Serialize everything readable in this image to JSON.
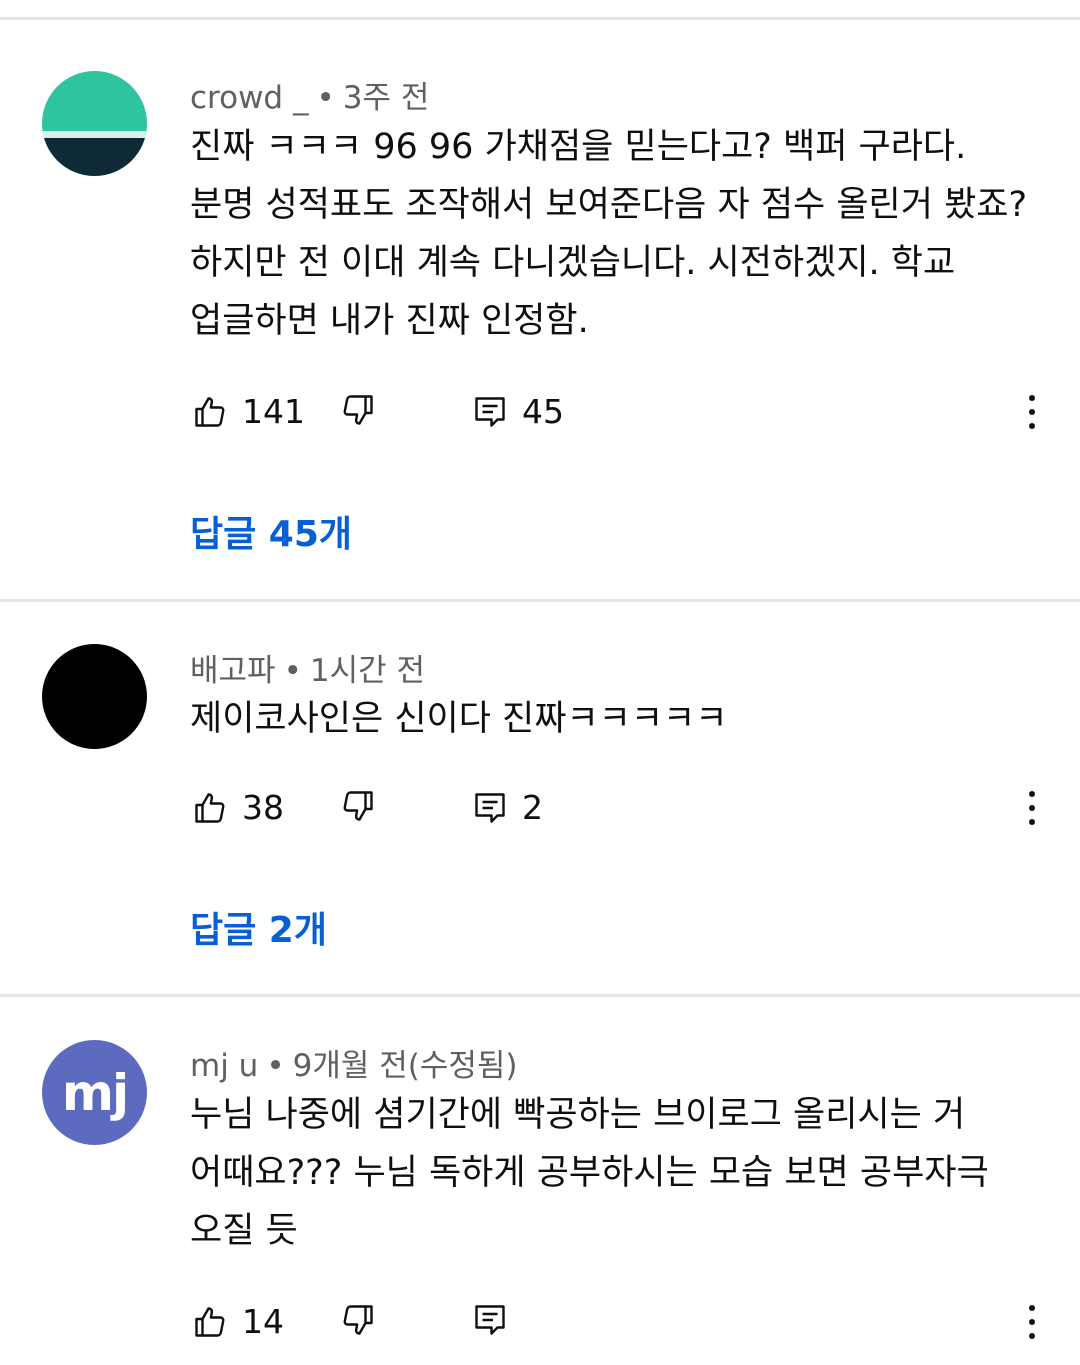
{
  "comments": [
    {
      "author": "crowd _",
      "time": "3주 전",
      "lines": [
        "진짜 ㅋㅋㅋ 96 96 가채점을 믿는다고? 백퍼 구라다.",
        "분명 성적표도 조작해서 보여준다음 자 점수 올린거 봤죠?",
        "하지만 전 이대 계속 다니겠습니다. 시전하겠지. 학교",
        "업글하면 내가 진짜 인정함."
      ],
      "likes": "141",
      "reply_count": "45",
      "replies_link": "답글 45개"
    },
    {
      "author": "배고파",
      "time": "1시간 전",
      "lines": [
        "제이코사인은 신이다 진짜ㅋㅋㅋㅋㅋ"
      ],
      "likes": "38",
      "reply_count": "2",
      "replies_link": "답글 2개"
    },
    {
      "author": "mj u",
      "time": "9개월 전(수정됨)",
      "avatar_letters": "mj",
      "lines": [
        "누님 나중에 셤기간에 빡공하는 브이로그 올리시는 거",
        "어때요??? 누님 독하게 공부하시는 모습 보면 공부자극",
        "오질 듯"
      ],
      "likes": "14",
      "reply_count": ""
    }
  ],
  "colors": {
    "link": "#065fd4",
    "meta": "#606060",
    "avatar_mj": "#5c6bc0",
    "avatar_teal": "#2ec4a0"
  },
  "icons": [
    "like-icon",
    "dislike-icon",
    "reply-icon",
    "more-options-icon"
  ]
}
